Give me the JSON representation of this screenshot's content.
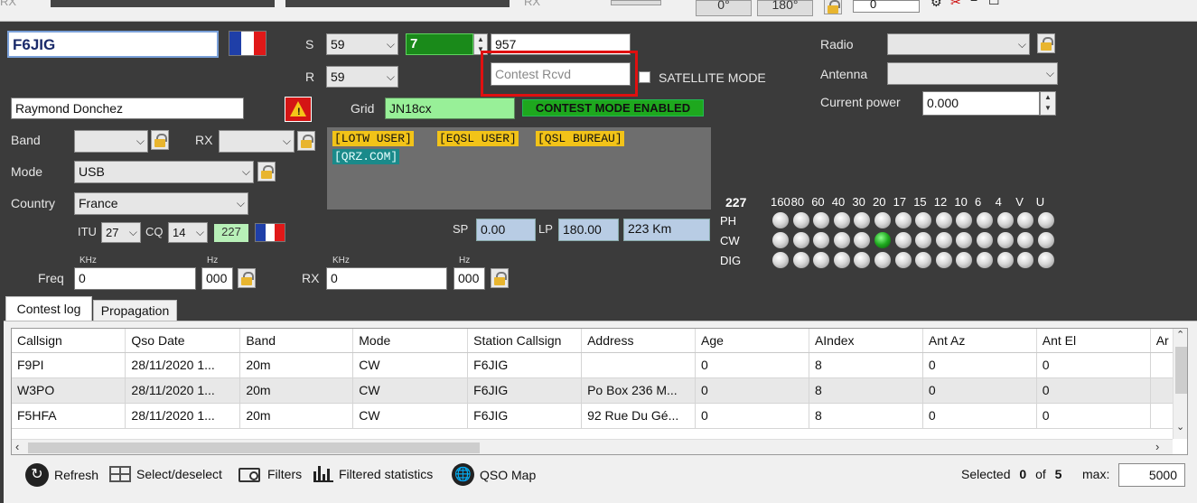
{
  "top_bar": {
    "rx1": "RX",
    "rx2": "RX",
    "az0": "0°",
    "az180": "180°",
    "spin_value": "0"
  },
  "qso": {
    "callsign": "F6JIG",
    "name": "Raymond Donchez",
    "s_label": "S",
    "s_value": "59",
    "r_label": "R",
    "r_value": "59",
    "serial_sent": "7",
    "serial_rcvd": "957",
    "contest_rcvd_placeholder": "Contest Rcvd",
    "satellite_label": "SATELLITE MODE",
    "grid_label": "Grid",
    "grid_value": "JN18cx",
    "contest_mode": "CONTEST MODE ENABLED",
    "band_label": "Band",
    "band_value": "",
    "rx_label": "RX",
    "rx_value": "",
    "mode_label": "Mode",
    "mode_value": "USB",
    "country_label": "Country",
    "country_value": "France",
    "itu_label": "ITU",
    "itu_value": "27",
    "cq_label": "CQ",
    "cq_value": "14",
    "dxcc": "227",
    "sp_label": "SP",
    "sp_value": "0.00",
    "lp_label": "LP",
    "lp_value": "180.00",
    "distance": "223 Km",
    "freq_label": "Freq",
    "freq_khz": "0",
    "freq_hz": "000",
    "rx_freq_label": "RX",
    "rx_freq_khz": "0",
    "rx_freq_hz": "000",
    "khz": "KHz",
    "hz": "Hz"
  },
  "tags": [
    "[LOTW USER]",
    "[EQSL USER]",
    "[QSL BUREAU]",
    "[QRZ.COM]"
  ],
  "station": {
    "radio_label": "Radio",
    "radio_value": "",
    "antenna_label": "Antenna",
    "antenna_value": "",
    "power_label": "Current power",
    "power_value": "0.000"
  },
  "band_map": {
    "dxcc": "227",
    "bands": [
      "160",
      "80",
      "60",
      "40",
      "30",
      "20",
      "17",
      "15",
      "12",
      "10",
      "6",
      "4",
      "V",
      "U"
    ],
    "rows": [
      "PH",
      "CW",
      "DIG"
    ],
    "active": {
      "row": "CW",
      "band": "20"
    }
  },
  "tabs": [
    "Contest log",
    "Propagation"
  ],
  "log_table": {
    "columns": [
      "Callsign",
      "Qso Date",
      "Band",
      "Mode",
      "Station Callsign",
      "Address",
      "Age",
      "AIndex",
      "Ant Az",
      "Ant El",
      "Ar"
    ],
    "rows": [
      [
        "F9PI",
        "28/11/2020 1...",
        "20m",
        "CW",
        "F6JIG",
        "",
        "0",
        "8",
        "0",
        "0"
      ],
      [
        "W3PO",
        "28/11/2020 1...",
        "20m",
        "CW",
        "F6JIG",
        "Po Box 236 M...",
        "0",
        "8",
        "0",
        "0"
      ],
      [
        "F5HFA",
        "28/11/2020 1...",
        "20m",
        "CW",
        "F6JIG",
        "92 Rue Du Gé...",
        "0",
        "8",
        "0",
        "0"
      ]
    ]
  },
  "toolbar": {
    "refresh": "Refresh",
    "select": "Select/deselect",
    "filters": "Filters",
    "stats": "Filtered statistics",
    "map": "QSO Map",
    "selected_label": "Selected",
    "selected": "0",
    "of_label": "of",
    "total": "5",
    "max_label": "max:",
    "max": "5000"
  },
  "colors": {
    "highlight": "#e01010",
    "grid_bg": "#98f098",
    "contest": "#1ea81e",
    "tag_yellow": "#f2c318",
    "tag_teal": "#1a8a8a",
    "info_blue": "#b8cce4"
  }
}
